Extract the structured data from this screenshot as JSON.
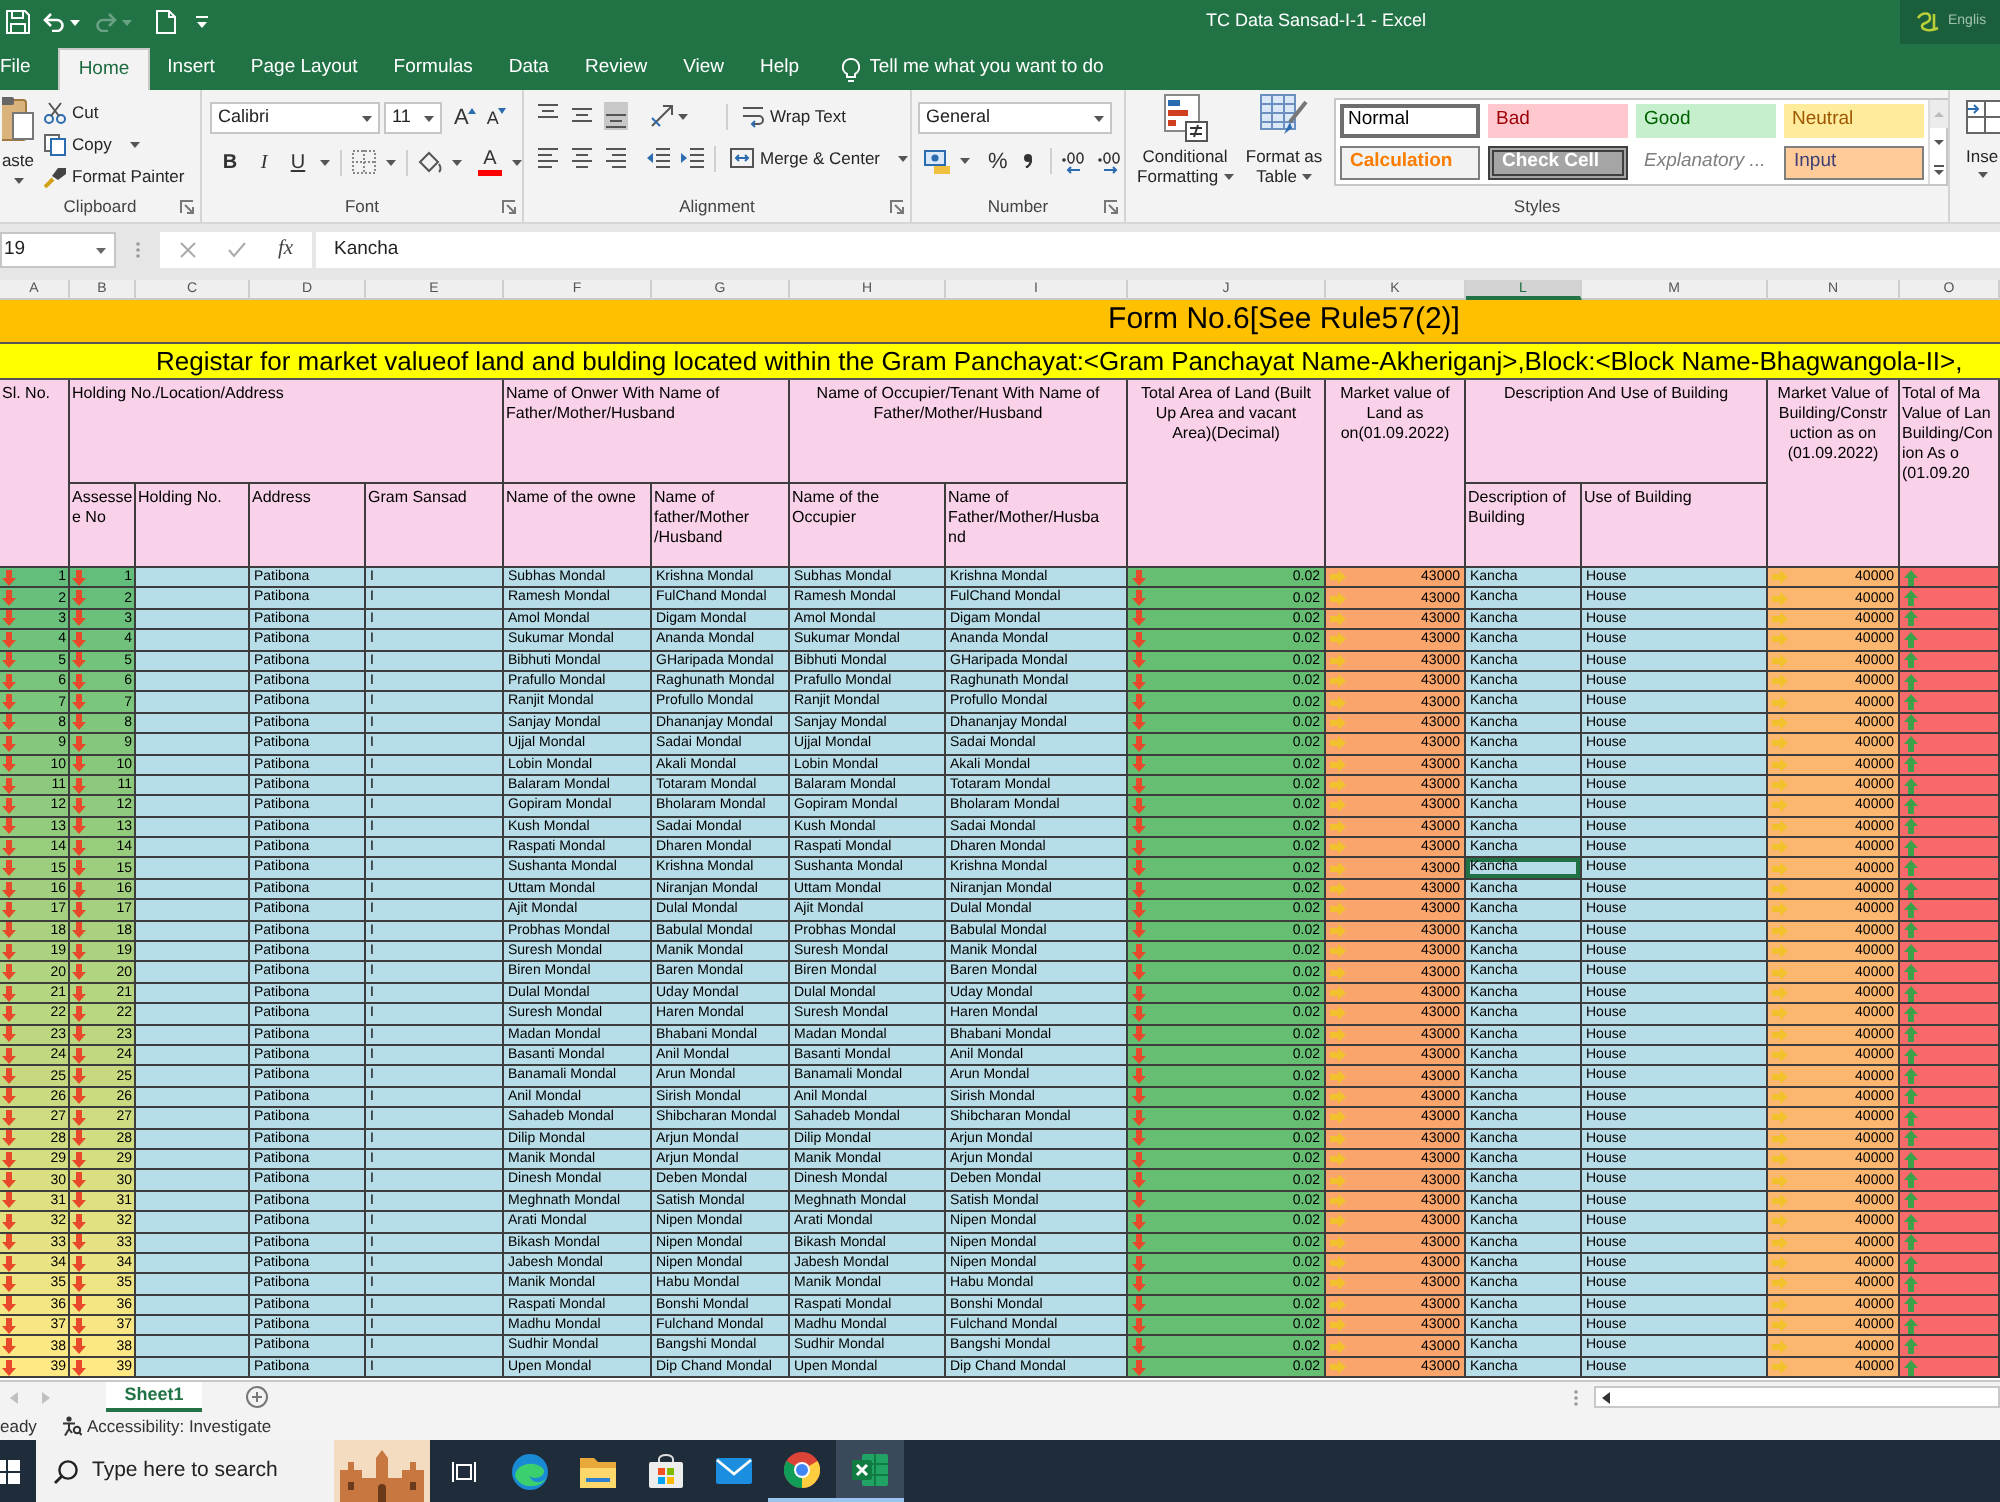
{
  "window": {
    "title": "TC Data Sansad-I-1 - Excel",
    "language_indicator": "Englis"
  },
  "ribbon_tabs": [
    {
      "label": "File",
      "selected": false
    },
    {
      "label": "Home",
      "selected": true
    },
    {
      "label": "Insert",
      "selected": false
    },
    {
      "label": "Page Layout",
      "selected": false
    },
    {
      "label": "Formulas",
      "selected": false
    },
    {
      "label": "Data",
      "selected": false
    },
    {
      "label": "Review",
      "selected": false
    },
    {
      "label": "View",
      "selected": false
    },
    {
      "label": "Help",
      "selected": false
    }
  ],
  "tell_me": {
    "placeholder": "Tell me what you want to do"
  },
  "ribbon": {
    "clipboard": {
      "paste": "aste",
      "cut": "Cut",
      "copy": "Copy",
      "format_painter": "Format Painter",
      "label": "Clipboard"
    },
    "font": {
      "font_name": "Calibri",
      "font_size": "11",
      "grow_font": "A",
      "shrink_font": "A",
      "toggles": [
        {
          "label": "B",
          "kind": "bold",
          "on": false
        },
        {
          "label": "I",
          "kind": "italic",
          "on": false
        },
        {
          "label": "U",
          "kind": "underline",
          "on": false
        }
      ],
      "font_color": "A",
      "label": "Font"
    },
    "alignment": {
      "vertical": [
        {
          "kind": "top",
          "on": false
        },
        {
          "kind": "middle",
          "on": false
        },
        {
          "kind": "bottom",
          "on": true
        }
      ],
      "horizontal": [
        {
          "kind": "left",
          "on": false
        },
        {
          "kind": "center",
          "on": false
        },
        {
          "kind": "right",
          "on": false
        }
      ],
      "wrap_text": "Wrap Text",
      "merge_center": "Merge & Center",
      "label": "Alignment"
    },
    "number": {
      "format": "General",
      "percent": "%",
      "label": "Number"
    },
    "styles": {
      "conditional_formatting": "Conditional\nFormatting",
      "format_as_table": "Format as\nTable",
      "cell_styles": [
        {
          "label": "Normal",
          "kind": "normal",
          "selected": true
        },
        {
          "label": "Bad",
          "kind": "bad",
          "selected": false
        },
        {
          "label": "Good",
          "kind": "good",
          "selected": false
        },
        {
          "label": "Neutral",
          "kind": "neutral",
          "selected": false
        },
        {
          "label": "Calculation",
          "kind": "calculation",
          "selected": false
        },
        {
          "label": "Check Cell",
          "kind": "check",
          "selected": false
        },
        {
          "label": "Explanatory ...",
          "kind": "explanatory",
          "selected": false
        },
        {
          "label": "Input",
          "kind": "input",
          "selected": false
        }
      ],
      "label": "Styles"
    },
    "cells": {
      "insert": "Inse"
    }
  },
  "formula_bar": {
    "name_box": "19",
    "function_label": "fx",
    "value": "Kancha"
  },
  "sheet": {
    "columns": [
      {
        "label": "A",
        "selected": false
      },
      {
        "label": "B",
        "selected": false
      },
      {
        "label": "C",
        "selected": false
      },
      {
        "label": "D",
        "selected": false
      },
      {
        "label": "E",
        "selected": false
      },
      {
        "label": "F",
        "selected": false
      },
      {
        "label": "G",
        "selected": false
      },
      {
        "label": "H",
        "selected": false
      },
      {
        "label": "I",
        "selected": false
      },
      {
        "label": "J",
        "selected": false
      },
      {
        "label": "K",
        "selected": false
      },
      {
        "label": "L",
        "selected": true
      },
      {
        "label": "M",
        "selected": false
      },
      {
        "label": "N",
        "selected": false
      },
      {
        "label": "O",
        "selected": false
      }
    ],
    "title": "Form No.6[See Rule57(2)]",
    "subtitle": "Registar for market valueof land and bulding located within the Gram Panchayat:<Gram Panchayat Name-Akheriganj>,Block:<Block Name-Bhagwangola-II>,",
    "header_groups": [
      "Sl. No.",
      "Holding No./Location/Address",
      "Name of Onwer With Name of\nFather/Mother/Husband",
      "Name of Occupier/Tenant With Name of\nFather/Mother/Husband",
      "Total Area of Land (Built\nUp Area and vacant\nArea)(Decimal)",
      "Market value of\nLand as\non(01.09.2022)",
      "Description And Use of Building",
      "Market Value of\nBuilding/Constr\nuction as on\n(01.09.2022)",
      "Total of Ma\nValue of Lan\nBuilding/Con\nion As o\n(01.09.20"
    ],
    "header_subs": [
      "Assesse\ne No",
      "Holding No.",
      "Address",
      "Gram Sansad",
      "Name of the owne",
      "Name of\nfather/Mother\n/Husband",
      "Name of the\nOccupier",
      "Name of\nFather/Mother/Husba\nnd",
      "Description of\nBuilding",
      "Use of Building"
    ],
    "rows": [
      {
        "sl_no": "1",
        "assessee_no": "1",
        "address": "Patibona",
        "gram_sansad": "I",
        "owner": "Subhas Mondal",
        "owner_relative": "Krishna Mondal",
        "occupier": "Subhas Mondal",
        "occupier_relative": "Krishna Mondal",
        "land_area": "0.02",
        "land_value": "43000",
        "building_description": "Kancha",
        "building_use": "House",
        "building_value": "40000",
        "selected": false
      },
      {
        "sl_no": "2",
        "assessee_no": "2",
        "address": "Patibona",
        "gram_sansad": "I",
        "owner": "Ramesh Mondal",
        "owner_relative": "FulChand Mondal",
        "occupier": "Ramesh Mondal",
        "occupier_relative": "FulChand Mondal",
        "land_area": "0.02",
        "land_value": "43000",
        "building_description": "Kancha",
        "building_use": "House",
        "building_value": "40000",
        "selected": false
      },
      {
        "sl_no": "3",
        "assessee_no": "3",
        "address": "Patibona",
        "gram_sansad": "I",
        "owner": "Amol Mondal",
        "owner_relative": "Digam Mondal",
        "occupier": "Amol Mondal",
        "occupier_relative": "Digam Mondal",
        "land_area": "0.02",
        "land_value": "43000",
        "building_description": "Kancha",
        "building_use": "House",
        "building_value": "40000",
        "selected": false
      },
      {
        "sl_no": "4",
        "assessee_no": "4",
        "address": "Patibona",
        "gram_sansad": "I",
        "owner": "Sukumar Mondal",
        "owner_relative": "Ananda Mondal",
        "occupier": "Sukumar Mondal",
        "occupier_relative": "Ananda Mondal",
        "land_area": "0.02",
        "land_value": "43000",
        "building_description": "Kancha",
        "building_use": "House",
        "building_value": "40000",
        "selected": false
      },
      {
        "sl_no": "5",
        "assessee_no": "5",
        "address": "Patibona",
        "gram_sansad": "I",
        "owner": "Bibhuti Mondal",
        "owner_relative": "GHaripada Mondal",
        "occupier": "Bibhuti Mondal",
        "occupier_relative": "GHaripada Mondal",
        "land_area": "0.02",
        "land_value": "43000",
        "building_description": "Kancha",
        "building_use": "House",
        "building_value": "40000",
        "selected": false
      },
      {
        "sl_no": "6",
        "assessee_no": "6",
        "address": "Patibona",
        "gram_sansad": "I",
        "owner": "Prafullo Mondal",
        "owner_relative": "Raghunath Mondal",
        "occupier": "Prafullo Mondal",
        "occupier_relative": "Raghunath Mondal",
        "land_area": "0.02",
        "land_value": "43000",
        "building_description": "Kancha",
        "building_use": "House",
        "building_value": "40000",
        "selected": false
      },
      {
        "sl_no": "7",
        "assessee_no": "7",
        "address": "Patibona",
        "gram_sansad": "I",
        "owner": "Ranjit Mondal",
        "owner_relative": "Profullo Mondal",
        "occupier": "Ranjit Mondal",
        "occupier_relative": "Profullo Mondal",
        "land_area": "0.02",
        "land_value": "43000",
        "building_description": "Kancha",
        "building_use": "House",
        "building_value": "40000",
        "selected": false
      },
      {
        "sl_no": "8",
        "assessee_no": "8",
        "address": "Patibona",
        "gram_sansad": "I",
        "owner": "Sanjay Mondal",
        "owner_relative": "Dhananjay Mondal",
        "occupier": "Sanjay Mondal",
        "occupier_relative": "Dhananjay Mondal",
        "land_area": "0.02",
        "land_value": "43000",
        "building_description": "Kancha",
        "building_use": "House",
        "building_value": "40000",
        "selected": false
      },
      {
        "sl_no": "9",
        "assessee_no": "9",
        "address": "Patibona",
        "gram_sansad": "I",
        "owner": "Ujjal Mondal",
        "owner_relative": "Sadai Mondal",
        "occupier": "Ujjal Mondal",
        "occupier_relative": "Sadai Mondal",
        "land_area": "0.02",
        "land_value": "43000",
        "building_description": "Kancha",
        "building_use": "House",
        "building_value": "40000",
        "selected": false
      },
      {
        "sl_no": "10",
        "assessee_no": "10",
        "address": "Patibona",
        "gram_sansad": "I",
        "owner": "Lobin Mondal",
        "owner_relative": "Akali Mondal",
        "occupier": "Lobin Mondal",
        "occupier_relative": "Akali Mondal",
        "land_area": "0.02",
        "land_value": "43000",
        "building_description": "Kancha",
        "building_use": "House",
        "building_value": "40000",
        "selected": false
      },
      {
        "sl_no": "11",
        "assessee_no": "11",
        "address": "Patibona",
        "gram_sansad": "I",
        "owner": "Balaram Mondal",
        "owner_relative": "Totaram Mondal",
        "occupier": "Balaram Mondal",
        "occupier_relative": "Totaram Mondal",
        "land_area": "0.02",
        "land_value": "43000",
        "building_description": "Kancha",
        "building_use": "House",
        "building_value": "40000",
        "selected": false
      },
      {
        "sl_no": "12",
        "assessee_no": "12",
        "address": "Patibona",
        "gram_sansad": "I",
        "owner": "Gopiram Mondal",
        "owner_relative": "Bholaram Mondal",
        "occupier": "Gopiram Mondal",
        "occupier_relative": "Bholaram Mondal",
        "land_area": "0.02",
        "land_value": "43000",
        "building_description": "Kancha",
        "building_use": "House",
        "building_value": "40000",
        "selected": false
      },
      {
        "sl_no": "13",
        "assessee_no": "13",
        "address": "Patibona",
        "gram_sansad": "I",
        "owner": "Kush Mondal",
        "owner_relative": "Sadai Mondal",
        "occupier": "Kush Mondal",
        "occupier_relative": "Sadai Mondal",
        "land_area": "0.02",
        "land_value": "43000",
        "building_description": "Kancha",
        "building_use": "House",
        "building_value": "40000",
        "selected": false
      },
      {
        "sl_no": "14",
        "assessee_no": "14",
        "address": "Patibona",
        "gram_sansad": "I",
        "owner": "Raspati Mondal",
        "owner_relative": "Dharen Mondal",
        "occupier": "Raspati Mondal",
        "occupier_relative": "Dharen Mondal",
        "land_area": "0.02",
        "land_value": "43000",
        "building_description": "Kancha",
        "building_use": "House",
        "building_value": "40000",
        "selected": false
      },
      {
        "sl_no": "15",
        "assessee_no": "15",
        "address": "Patibona",
        "gram_sansad": "I",
        "owner": "Sushanta Mondal",
        "owner_relative": "Krishna Mondal",
        "occupier": "Sushanta Mondal",
        "occupier_relative": "Krishna Mondal",
        "land_area": "0.02",
        "land_value": "43000",
        "building_description": "Kancha",
        "building_use": "House",
        "building_value": "40000",
        "selected": true
      },
      {
        "sl_no": "16",
        "assessee_no": "16",
        "address": "Patibona",
        "gram_sansad": "I",
        "owner": "Uttam Mondal",
        "owner_relative": "Niranjan Mondal",
        "occupier": "Uttam Mondal",
        "occupier_relative": "Niranjan Mondal",
        "land_area": "0.02",
        "land_value": "43000",
        "building_description": "Kancha",
        "building_use": "House",
        "building_value": "40000",
        "selected": false
      },
      {
        "sl_no": "17",
        "assessee_no": "17",
        "address": "Patibona",
        "gram_sansad": "I",
        "owner": "Ajit Mondal",
        "owner_relative": "Dulal Mondal",
        "occupier": "Ajit Mondal",
        "occupier_relative": "Dulal Mondal",
        "land_area": "0.02",
        "land_value": "43000",
        "building_description": "Kancha",
        "building_use": "House",
        "building_value": "40000",
        "selected": false
      },
      {
        "sl_no": "18",
        "assessee_no": "18",
        "address": "Patibona",
        "gram_sansad": "I",
        "owner": "Probhas Mondal",
        "owner_relative": "Babulal Mondal",
        "occupier": "Probhas Mondal",
        "occupier_relative": "Babulal Mondal",
        "land_area": "0.02",
        "land_value": "43000",
        "building_description": "Kancha",
        "building_use": "House",
        "building_value": "40000",
        "selected": false
      },
      {
        "sl_no": "19",
        "assessee_no": "19",
        "address": "Patibona",
        "gram_sansad": "I",
        "owner": "Suresh Mondal",
        "owner_relative": "Manik Mondal",
        "occupier": "Suresh Mondal",
        "occupier_relative": "Manik Mondal",
        "land_area": "0.02",
        "land_value": "43000",
        "building_description": "Kancha",
        "building_use": "House",
        "building_value": "40000",
        "selected": false
      },
      {
        "sl_no": "20",
        "assessee_no": "20",
        "address": "Patibona",
        "gram_sansad": "I",
        "owner": "Biren Mondal",
        "owner_relative": "Baren Mondal",
        "occupier": "Biren Mondal",
        "occupier_relative": "Baren Mondal",
        "land_area": "0.02",
        "land_value": "43000",
        "building_description": "Kancha",
        "building_use": "House",
        "building_value": "40000",
        "selected": false
      },
      {
        "sl_no": "21",
        "assessee_no": "21",
        "address": "Patibona",
        "gram_sansad": "I",
        "owner": "Dulal Mondal",
        "owner_relative": "Uday Mondal",
        "occupier": "Dulal Mondal",
        "occupier_relative": "Uday Mondal",
        "land_area": "0.02",
        "land_value": "43000",
        "building_description": "Kancha",
        "building_use": "House",
        "building_value": "40000",
        "selected": false
      },
      {
        "sl_no": "22",
        "assessee_no": "22",
        "address": "Patibona",
        "gram_sansad": "I",
        "owner": "Suresh Mondal",
        "owner_relative": "Haren Mondal",
        "occupier": "Suresh Mondal",
        "occupier_relative": "Haren Mondal",
        "land_area": "0.02",
        "land_value": "43000",
        "building_description": "Kancha",
        "building_use": "House",
        "building_value": "40000",
        "selected": false
      },
      {
        "sl_no": "23",
        "assessee_no": "23",
        "address": "Patibona",
        "gram_sansad": "I",
        "owner": "Madan Mondal",
        "owner_relative": "Bhabani Mondal",
        "occupier": "Madan Mondal",
        "occupier_relative": "Bhabani Mondal",
        "land_area": "0.02",
        "land_value": "43000",
        "building_description": "Kancha",
        "building_use": "House",
        "building_value": "40000",
        "selected": false
      },
      {
        "sl_no": "24",
        "assessee_no": "24",
        "address": "Patibona",
        "gram_sansad": "I",
        "owner": "Basanti Mondal",
        "owner_relative": "Anil Mondal",
        "occupier": "Basanti Mondal",
        "occupier_relative": "Anil Mondal",
        "land_area": "0.02",
        "land_value": "43000",
        "building_description": "Kancha",
        "building_use": "House",
        "building_value": "40000",
        "selected": false
      },
      {
        "sl_no": "25",
        "assessee_no": "25",
        "address": "Patibona",
        "gram_sansad": "I",
        "owner": "Banamali Mondal",
        "owner_relative": "Arun Mondal",
        "occupier": "Banamali Mondal",
        "occupier_relative": "Arun Mondal",
        "land_area": "0.02",
        "land_value": "43000",
        "building_description": "Kancha",
        "building_use": "House",
        "building_value": "40000",
        "selected": false
      },
      {
        "sl_no": "26",
        "assessee_no": "26",
        "address": "Patibona",
        "gram_sansad": "I",
        "owner": "Anil Mondal",
        "owner_relative": "Sirish Mondal",
        "occupier": "Anil Mondal",
        "occupier_relative": "Sirish Mondal",
        "land_area": "0.02",
        "land_value": "43000",
        "building_description": "Kancha",
        "building_use": "House",
        "building_value": "40000",
        "selected": false
      },
      {
        "sl_no": "27",
        "assessee_no": "27",
        "address": "Patibona",
        "gram_sansad": "I",
        "owner": "Sahadeb Mondal",
        "owner_relative": "Shibcharan Mondal",
        "occupier": "Sahadeb Mondal",
        "occupier_relative": "Shibcharan Mondal",
        "land_area": "0.02",
        "land_value": "43000",
        "building_description": "Kancha",
        "building_use": "House",
        "building_value": "40000",
        "selected": false
      },
      {
        "sl_no": "28",
        "assessee_no": "28",
        "address": "Patibona",
        "gram_sansad": "I",
        "owner": "Dilip Mondal",
        "owner_relative": "Arjun Mondal",
        "occupier": "Dilip Mondal",
        "occupier_relative": "Arjun Mondal",
        "land_area": "0.02",
        "land_value": "43000",
        "building_description": "Kancha",
        "building_use": "House",
        "building_value": "40000",
        "selected": false
      },
      {
        "sl_no": "29",
        "assessee_no": "29",
        "address": "Patibona",
        "gram_sansad": "I",
        "owner": "Manik Mondal",
        "owner_relative": "Arjun Mondal",
        "occupier": "Manik Mondal",
        "occupier_relative": "Arjun Mondal",
        "land_area": "0.02",
        "land_value": "43000",
        "building_description": "Kancha",
        "building_use": "House",
        "building_value": "40000",
        "selected": false
      },
      {
        "sl_no": "30",
        "assessee_no": "30",
        "address": "Patibona",
        "gram_sansad": "I",
        "owner": "Dinesh Mondal",
        "owner_relative": "Deben Mondal",
        "occupier": "Dinesh Mondal",
        "occupier_relative": "Deben Mondal",
        "land_area": "0.02",
        "land_value": "43000",
        "building_description": "Kancha",
        "building_use": "House",
        "building_value": "40000",
        "selected": false
      },
      {
        "sl_no": "31",
        "assessee_no": "31",
        "address": "Patibona",
        "gram_sansad": "I",
        "owner": "Meghnath Mondal",
        "owner_relative": "Satish Mondal",
        "occupier": "Meghnath Mondal",
        "occupier_relative": "Satish Mondal",
        "land_area": "0.02",
        "land_value": "43000",
        "building_description": "Kancha",
        "building_use": "House",
        "building_value": "40000",
        "selected": false
      },
      {
        "sl_no": "32",
        "assessee_no": "32",
        "address": "Patibona",
        "gram_sansad": "I",
        "owner": "Arati Mondal",
        "owner_relative": "Nipen Mondal",
        "occupier": "Arati Mondal",
        "occupier_relative": "Nipen Mondal",
        "land_area": "0.02",
        "land_value": "43000",
        "building_description": "Kancha",
        "building_use": "House",
        "building_value": "40000",
        "selected": false
      },
      {
        "sl_no": "33",
        "assessee_no": "33",
        "address": "Patibona",
        "gram_sansad": "I",
        "owner": "Bikash Mondal",
        "owner_relative": "Nipen Mondal",
        "occupier": "Bikash Mondal",
        "occupier_relative": "Nipen Mondal",
        "land_area": "0.02",
        "land_value": "43000",
        "building_description": "Kancha",
        "building_use": "House",
        "building_value": "40000",
        "selected": false
      },
      {
        "sl_no": "34",
        "assessee_no": "34",
        "address": "Patibona",
        "gram_sansad": "I",
        "owner": "Jabesh Mondal",
        "owner_relative": "Nipen Mondal",
        "occupier": "Jabesh Mondal",
        "occupier_relative": "Nipen Mondal",
        "land_area": "0.02",
        "land_value": "43000",
        "building_description": "Kancha",
        "building_use": "House",
        "building_value": "40000",
        "selected": false
      },
      {
        "sl_no": "35",
        "assessee_no": "35",
        "address": "Patibona",
        "gram_sansad": "I",
        "owner": "Manik Mondal",
        "owner_relative": "Habu Mondal",
        "occupier": "Manik Mondal",
        "occupier_relative": "Habu Mondal",
        "land_area": "0.02",
        "land_value": "43000",
        "building_description": "Kancha",
        "building_use": "House",
        "building_value": "40000",
        "selected": false
      },
      {
        "sl_no": "36",
        "assessee_no": "36",
        "address": "Patibona",
        "gram_sansad": "I",
        "owner": "Raspati Mondal",
        "owner_relative": "Bonshi Mondal",
        "occupier": "Raspati Mondal",
        "occupier_relative": "Bonshi Mondal",
        "land_area": "0.02",
        "land_value": "43000",
        "building_description": "Kancha",
        "building_use": "House",
        "building_value": "40000",
        "selected": false
      },
      {
        "sl_no": "37",
        "assessee_no": "37",
        "address": "Patibona",
        "gram_sansad": "I",
        "owner": "Madhu Mondal",
        "owner_relative": "Fulchand Mondal",
        "occupier": "Madhu Mondal",
        "occupier_relative": "Fulchand Mondal",
        "land_area": "0.02",
        "land_value": "43000",
        "building_description": "Kancha",
        "building_use": "House",
        "building_value": "40000",
        "selected": false
      },
      {
        "sl_no": "38",
        "assessee_no": "38",
        "address": "Patibona",
        "gram_sansad": "I",
        "owner": "Sudhir Mondal",
        "owner_relative": "Bangshi Mondal",
        "occupier": "Sudhir Mondal",
        "occupier_relative": "Bangshi Mondal",
        "land_area": "0.02",
        "land_value": "43000",
        "building_description": "Kancha",
        "building_use": "House",
        "building_value": "40000",
        "selected": false
      },
      {
        "sl_no": "39",
        "assessee_no": "39",
        "address": "Patibona",
        "gram_sansad": "I",
        "owner": "Upen Mondal",
        "owner_relative": "Dip Chand Mondal",
        "occupier": "Upen Mondal",
        "occupier_relative": "Dip Chand Mondal",
        "land_area": "0.02",
        "land_value": "43000",
        "building_description": "Kancha",
        "building_use": "House",
        "building_value": "40000",
        "selected": false
      }
    ]
  },
  "sheet_tabs": [
    {
      "label": "Sheet1",
      "selected": true
    }
  ],
  "status_bar": {
    "mode": "eady",
    "accessibility": "Accessibility: Investigate"
  },
  "taskbar": {
    "search_placeholder": "Type here to search",
    "apps": [
      {
        "kind": "edge",
        "open": false,
        "active": false
      },
      {
        "kind": "explorer",
        "open": false,
        "active": false
      },
      {
        "kind": "store",
        "open": false,
        "active": false
      },
      {
        "kind": "mail",
        "open": false,
        "active": false
      },
      {
        "kind": "chrome",
        "open": true,
        "active": false
      },
      {
        "kind": "excel",
        "open": true,
        "active": true
      }
    ]
  }
}
